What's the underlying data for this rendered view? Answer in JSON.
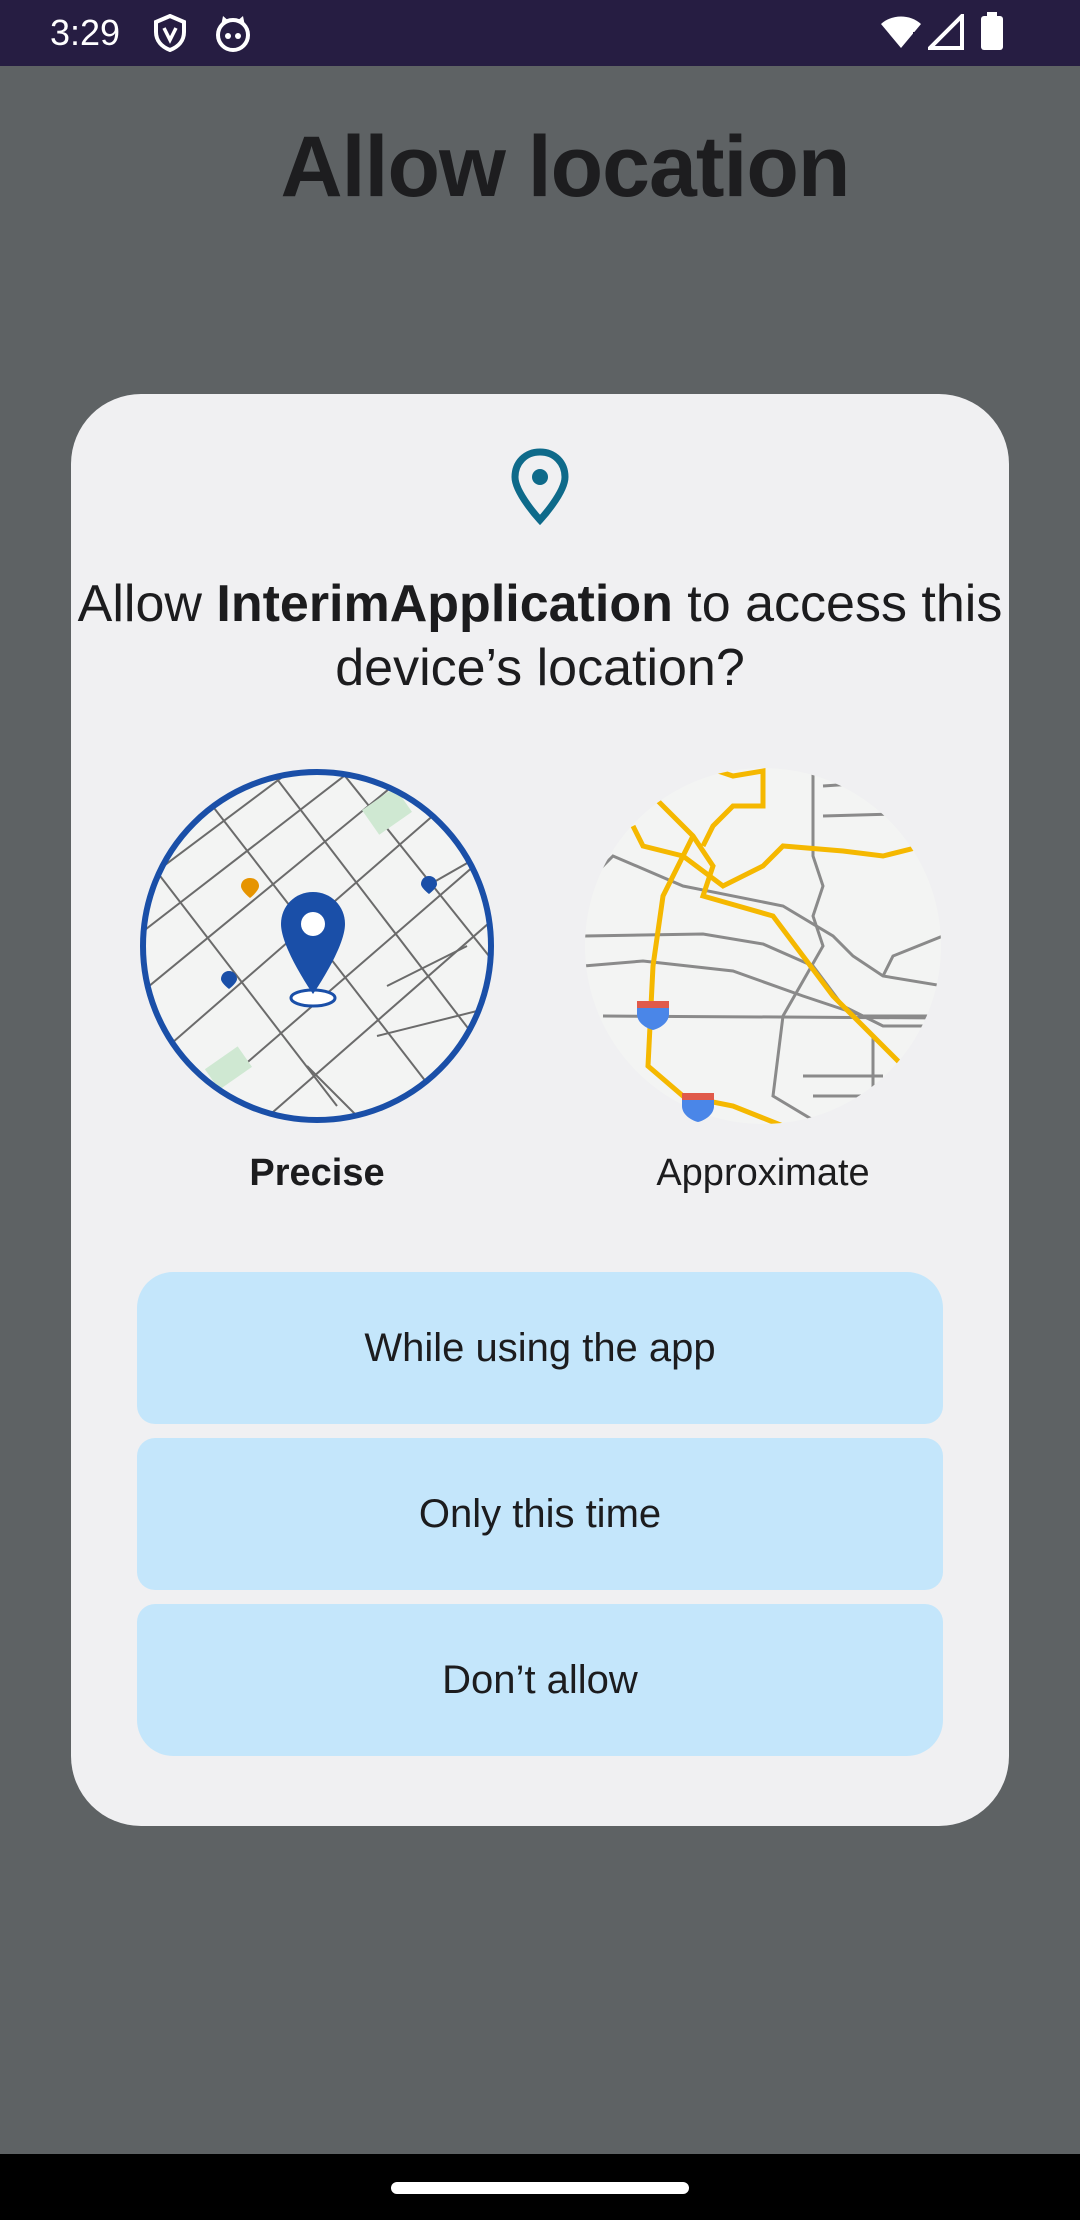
{
  "status_bar": {
    "time": "3:29",
    "left_icons": [
      "shield-icon",
      "cat-icon"
    ],
    "right_icons": [
      "wifi-icon",
      "cellular-signal-icon",
      "battery-icon"
    ]
  },
  "app": {
    "title": "Allow location"
  },
  "dialog": {
    "icon": "location-pin-icon",
    "title_prefix": "Allow ",
    "app_name": "InterimApplication",
    "title_suffix": " to access this device’s location?",
    "options": [
      {
        "label": "Precise",
        "selected": true
      },
      {
        "label": "Approximate",
        "selected": false
      }
    ],
    "buttons": {
      "while_using": "While using the app",
      "only_this_time": "Only this time",
      "dont_allow": "Don’t allow"
    }
  },
  "colors": {
    "scrim": "#5e6264",
    "dialog_bg": "#f0f0f2",
    "button_bg": "#c4e6fb",
    "accent_blue": "#1a4fa8",
    "road_yellow": "#f5b800",
    "status_bar": "#261d42"
  }
}
